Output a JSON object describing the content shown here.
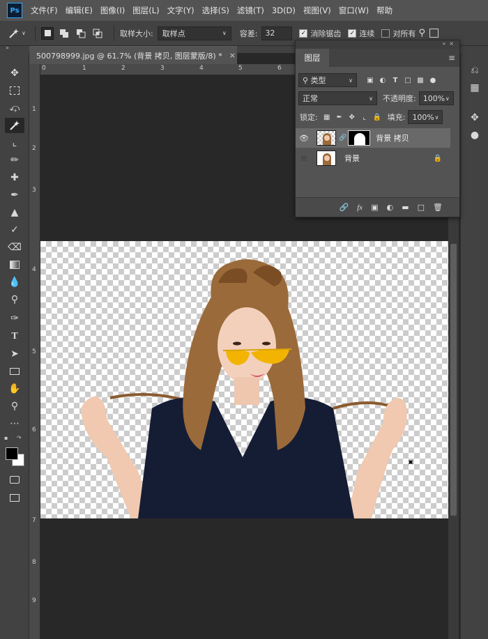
{
  "menubar": {
    "logo": "Ps",
    "items": [
      "文件(F)",
      "编辑(E)",
      "图像(I)",
      "图层(L)",
      "文字(Y)",
      "选择(S)",
      "滤镜(T)",
      "3D(D)",
      "视图(V)",
      "窗口(W)",
      "帮助"
    ]
  },
  "options": {
    "sample_size_label": "取样大小:",
    "sample_size_value": "取样点",
    "tolerance_label": "容差:",
    "tolerance_value": "32",
    "antialias_label": "消除锯齿",
    "antialias_checked": true,
    "contiguous_label": "连续",
    "contiguous_checked": true,
    "all_layers_label": "对所有",
    "all_layers_checked": false
  },
  "document": {
    "tab_title": "500798999.jpg @ 61.7% (背景 拷贝, 图层蒙版/8) *",
    "close_glyph": "×"
  },
  "rulers": {
    "top": [
      "0",
      "1",
      "2",
      "3",
      "4",
      "5",
      "6"
    ],
    "left": [
      "1",
      "2",
      "3",
      "4",
      "5",
      "6",
      "7",
      "8",
      "9"
    ]
  },
  "layers_panel": {
    "title": "图层",
    "filter_kind": "类型",
    "blend_mode": "正常",
    "opacity_label": "不透明度:",
    "opacity_value": "100%",
    "lock_label": "锁定:",
    "fill_label": "填充:",
    "fill_value": "100%",
    "layers": [
      {
        "name": "背景 拷贝",
        "visible": true,
        "selected": true,
        "has_mask": true,
        "locked": false
      },
      {
        "name": "背景",
        "visible": false,
        "selected": false,
        "has_mask": false,
        "locked": true
      }
    ]
  },
  "colors": {
    "foreground": "#000000",
    "background": "#ffffff",
    "ps_accent": "#31a8ff"
  }
}
